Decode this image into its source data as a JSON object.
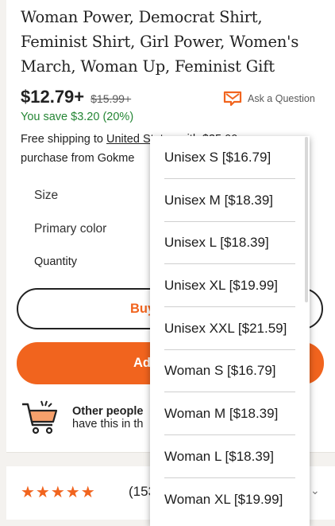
{
  "listing": {
    "title": "Woman Power, Democrat Shirt, Feminist Shirt, Girl Power, Women's March, Woman Up, Feminist Gift",
    "price": "$12.79+",
    "old_price": "$15.99+",
    "savings": "You save $3.20 (20%)",
    "ask_question": "Ask a Question",
    "shipping_pre": "Free shipping to ",
    "shipping_link": "United States",
    "shipping_post": " with $35.00 purchase from Gokme"
  },
  "options": {
    "size_label": "Size",
    "color_label": "Primary color",
    "quantity_label": "Quantity"
  },
  "actions": {
    "buy_label": "Buy",
    "add_label": "Ad"
  },
  "social": {
    "line1": "Other people",
    "line2": "have this in th"
  },
  "reviews": {
    "stars": "★★★★★",
    "count": "(153"
  },
  "size_menu": {
    "items": [
      "Unisex S [$16.79]",
      "Unisex M [$18.39]",
      "Unisex L [$18.39]",
      "Unisex XL [$19.99]",
      "Unisex XXL [$21.59]",
      "Woman S [$16.79]",
      "Woman M [$18.39]",
      "Woman L [$18.39]",
      "Woman XL [$19.99]"
    ]
  },
  "colors": {
    "accent": "#f1641e",
    "savings": "#258635"
  },
  "icons": [
    "mail-question-icon",
    "shopping-cart-icon",
    "star-icon",
    "chevron-down-icon"
  ]
}
